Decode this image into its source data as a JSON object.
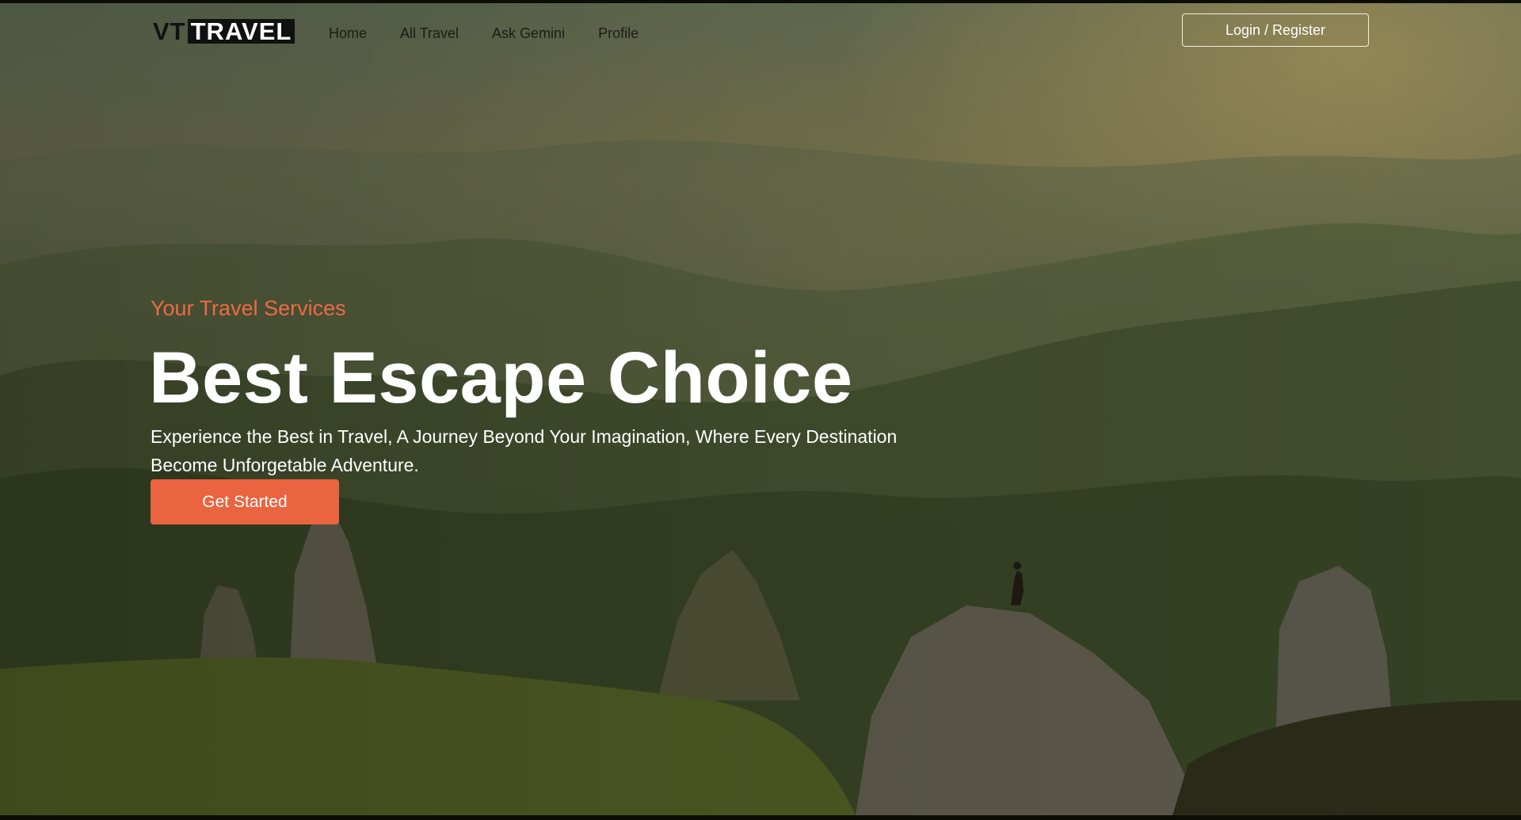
{
  "brand": {
    "logo_part1": "VT",
    "logo_part2": "TRAVEL"
  },
  "nav": {
    "links": [
      "Home",
      "All Travel",
      "Ask Gemini",
      "Profile"
    ],
    "login_label": "Login / Register"
  },
  "hero": {
    "eyebrow": "Your Travel Services",
    "headline": "Best Escape Choice",
    "subtitle": "Experience the Best in Travel, A Journey Beyond Your Imagination, Where Every Destination Become Unforgetable Adventure.",
    "cta_label": "Get Started"
  },
  "colors": {
    "accent": "#ea6440",
    "eyebrow": "#ee6a45",
    "text_light": "#ffffff",
    "nav_text": "#1c1c14"
  }
}
